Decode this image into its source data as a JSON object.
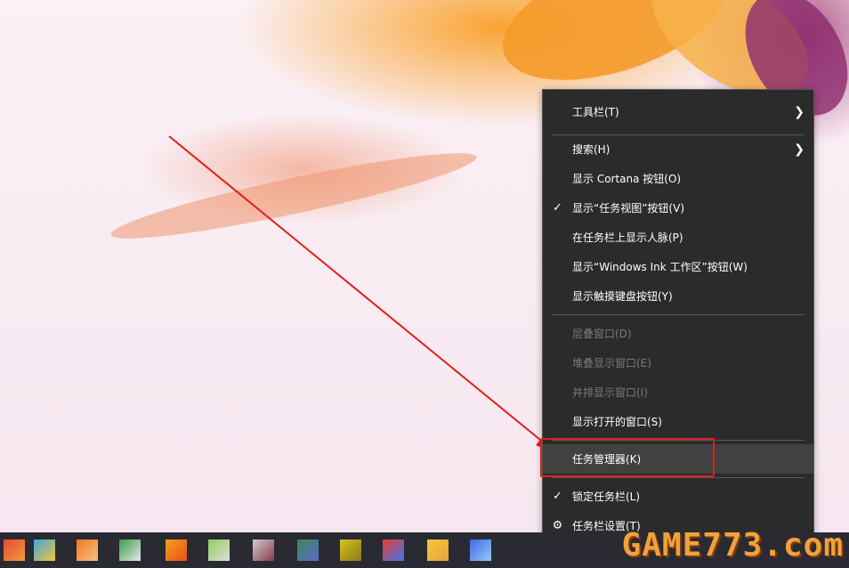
{
  "menu": {
    "items": [
      {
        "label": "工具栏(T)"
      },
      {
        "label": "搜索(H)"
      },
      {
        "label": "显示 Cortana 按钮(O)"
      },
      {
        "label": "显示“任务视图”按钮(V)",
        "checked": true
      },
      {
        "label": "在任务栏上显示人脉(P)"
      },
      {
        "label": "显示“Windows Ink 工作区”按钮(W)"
      },
      {
        "label": "显示触摸键盘按钮(Y)"
      },
      {
        "label": "层叠窗口(D)",
        "disabled": true
      },
      {
        "label": "堆叠显示窗口(E)",
        "disabled": true
      },
      {
        "label": "并排显示窗口(I)",
        "disabled": true
      },
      {
        "label": "显示打开的窗口(S)"
      },
      {
        "label": "任务管理器(K)",
        "highlighted": true
      },
      {
        "label": "锁定任务栏(L)",
        "checked": true
      },
      {
        "label": "任务栏设置(T)"
      }
    ]
  },
  "icons": {
    "submenu": "chevron-right-icon",
    "check": "checkmark-icon",
    "settings": "gear-icon"
  },
  "annotation": {
    "color": "#e0201a"
  },
  "watermark": {
    "text": "GAME773.com"
  }
}
